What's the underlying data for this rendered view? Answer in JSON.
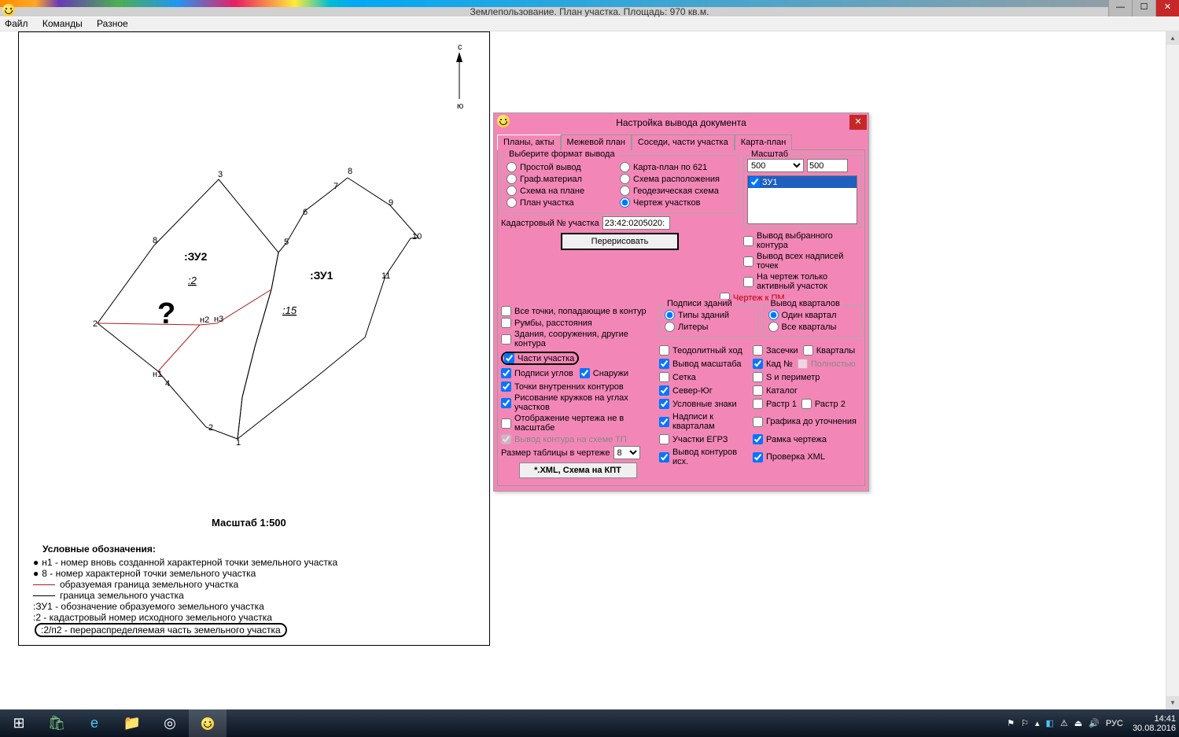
{
  "window": {
    "title": "Землепользование. План участка. Площадь: 970 кв.м."
  },
  "menu": {
    "file": "Файл",
    "commands": "Команды",
    "misc": "Разное"
  },
  "plan": {
    "scale": "Масштаб 1:500",
    "zu1": ":ЗУ1",
    "zu2": ":ЗУ2",
    "s2": ":2",
    "s15": ":15",
    "compass_n": "с",
    "compass_s": "ю",
    "legend_title": "Условные обозначения:",
    "legend": {
      "l1": "н1 - номер вновь созданной характерной точки земельного участка",
      "l2": "8  - номер характерной точки земельного участка",
      "l3": "образуемая граница земельного участка",
      "l4": "граница земельного участка",
      "l5": ":ЗУ1  - обозначение образуемого земельного участка",
      "l6": ":2   - кадастровый номер исходного земельного участка",
      "l7": ":2/п2  - перераспределяемая часть земельного участка"
    }
  },
  "dialog": {
    "title": "Настройка вывода документа",
    "tabs": {
      "plans": "Планы, акты",
      "mej": "Межевой план",
      "sosedi": "Соседи, части участка",
      "karta": "Карта-план"
    },
    "format_group": "Выберите формат вывода",
    "fmt": {
      "simple": "Простой вывод",
      "kpt": "Карта-план по 621",
      "graph": "Граф.материал",
      "schema": "Схема расположения",
      "splan": "Схема на плане",
      "geod": "Геодезическая схема",
      "plan": "План участка",
      "chert": "Чертеж участков"
    },
    "scale_group": "Масштаб",
    "scale_val": "500",
    "scale_val2": "500",
    "list_item": "ЗУ1",
    "outputs": {
      "o1": "Вывод выбранного контура",
      "o2": "Вывод всех надписей точек",
      "o3": "На чертеж только активный участок"
    },
    "cad_label": "Кадастровый № участка",
    "cad_val": "23:42:0205020:",
    "redraw": "Перерисовать",
    "cpm": "Чертеж к ПМ",
    "opts": {
      "allpts": "Все точки, попадающие в контур",
      "rumbs": "Румбы, расстояния",
      "zdn": "Здания, сооружения, другие контура",
      "parts": "Части участка",
      "podp": "Подписи углов",
      "snar": "Снаружи",
      "intpts": "Точки внутренних контуров",
      "circles": "Рисование кружков на углах участков",
      "notscale": "Отображение чертежа не в масштабе",
      "tp": "Вывод контура на схеме ТП"
    },
    "tblsize": "Размер таблицы в чертеже",
    "tblval": "8",
    "xmlbtn": "*.XML, Схема на КПТ",
    "g_build": "Подписи зданий",
    "b_types": "Типы зданий",
    "b_liter": "Литеры",
    "g_kv": "Вывод кварталов",
    "kv_one": "Один квартал",
    "kv_all": "Все кварталы",
    "cb": {
      "teod": "Теодолитный ход",
      "mass": "Вывод масштаба",
      "grid": "Сетка",
      "nsouth": "Север-Юг",
      "symbols": "Условные знаки",
      "nadkv": "Надписи к кварталам",
      "egrz": "Участки ЕГРЗ",
      "outk": "Вывод контуров исх.",
      "zasech": "Засечки",
      "kadn": "Кад №",
      "sip": "S и периметр",
      "katalog": "Каталог",
      "r1": "Растр 1",
      "r2": "Растр 2",
      "gu": "Графика до уточнения",
      "ramka": "Рамка чертежа",
      "xmlc": "Проверка XML",
      "kvart": "Кварталы",
      "poln": "Полностью"
    }
  },
  "tray": {
    "lang": "РУС",
    "time": "14:41",
    "date": "30.08.2016"
  }
}
